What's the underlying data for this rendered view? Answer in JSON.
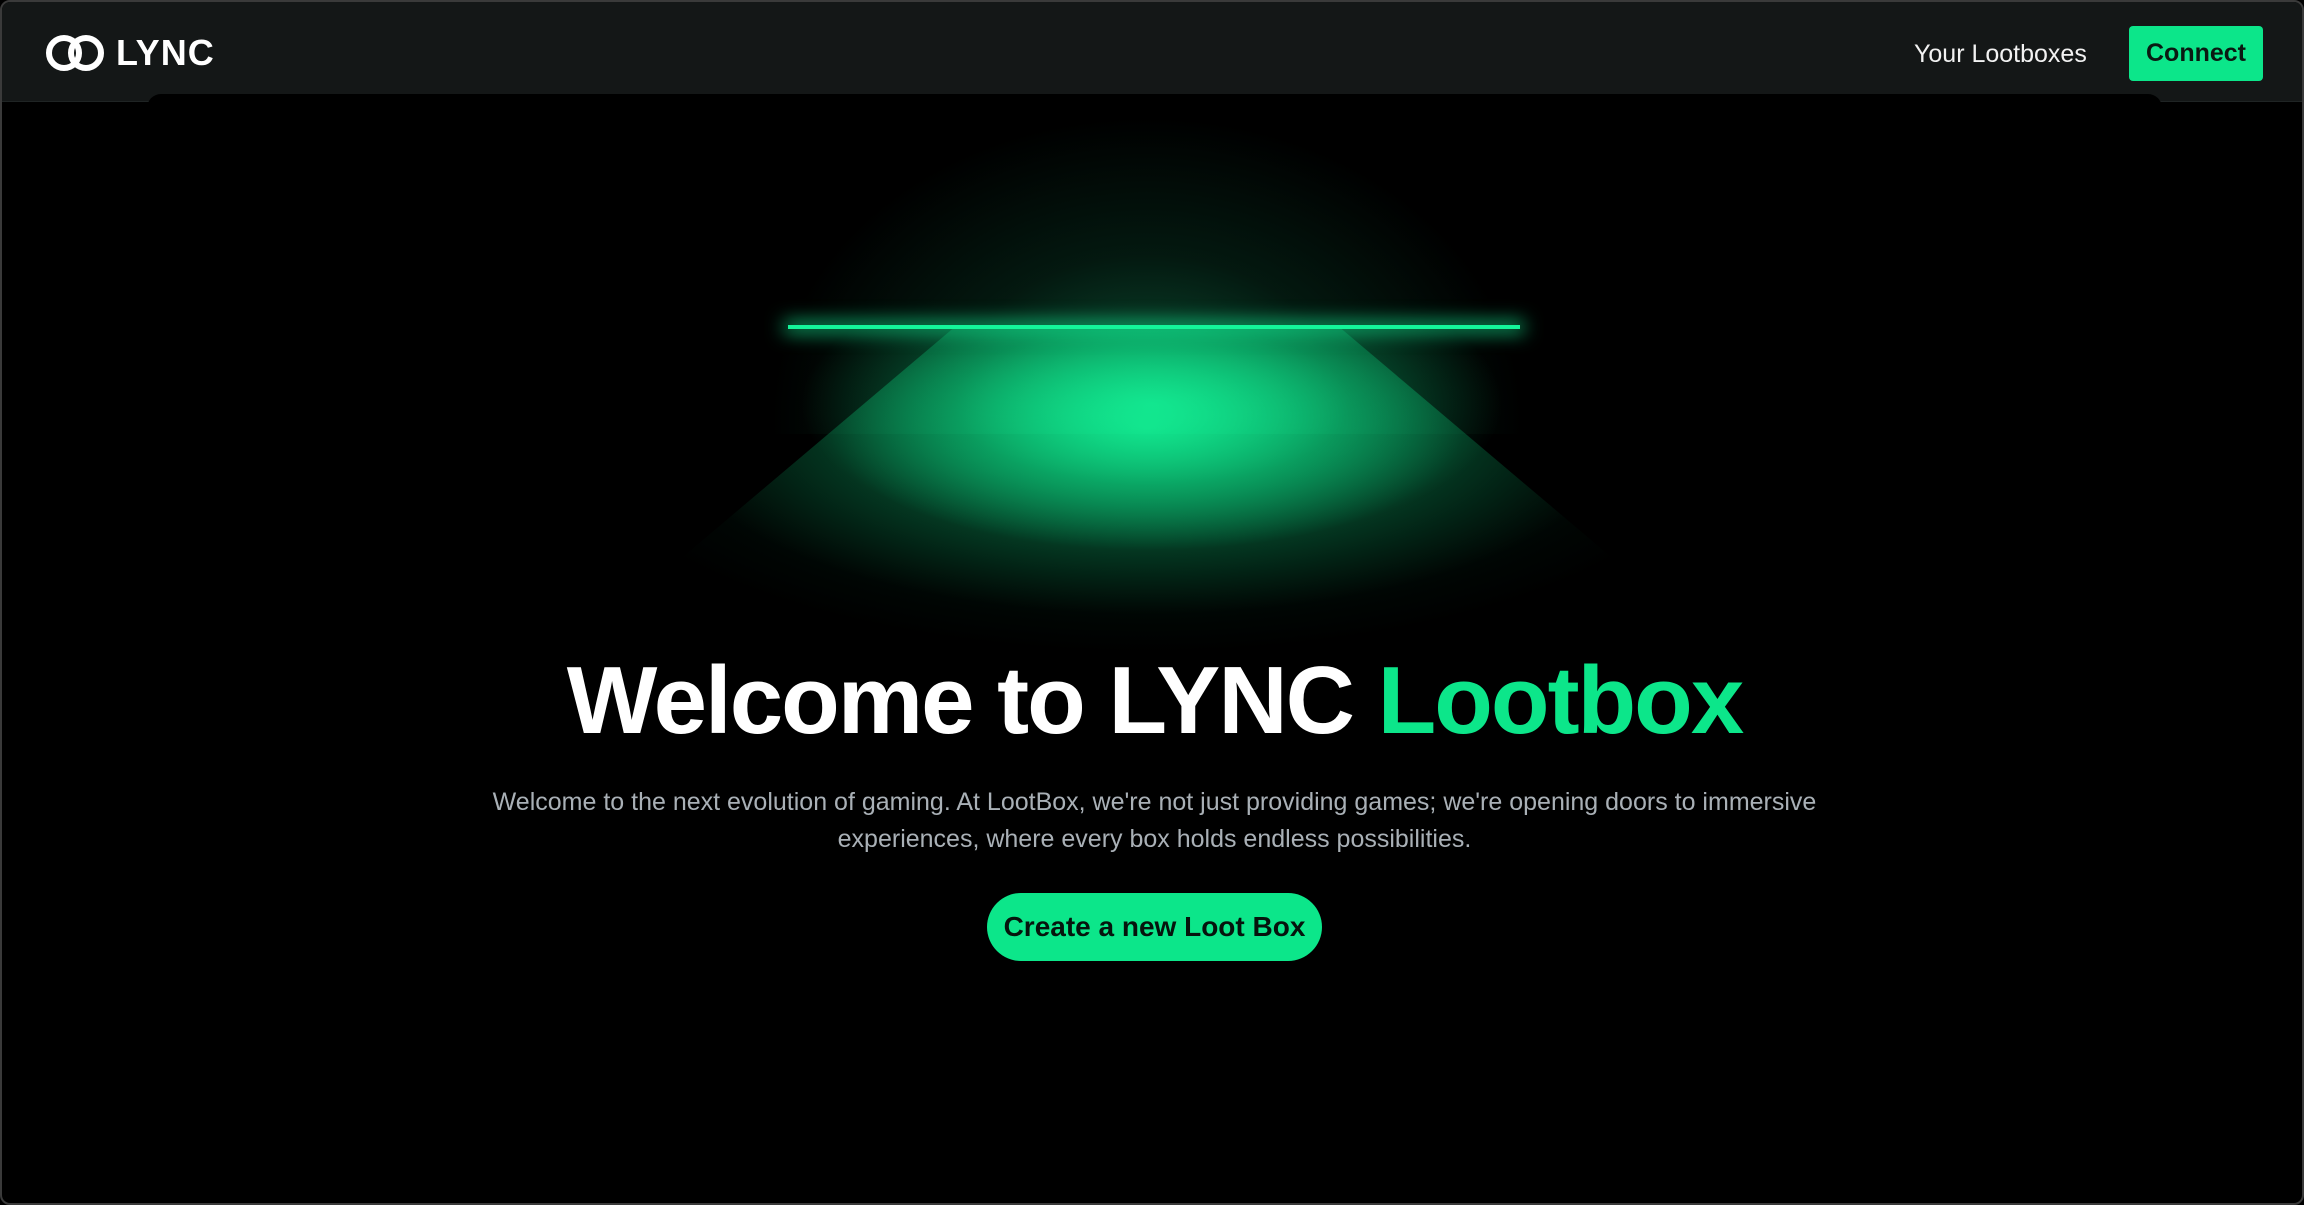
{
  "brand": {
    "name": "LYNC",
    "accent_color": "#0ce68a",
    "logo_icon": "linked-rings-icon"
  },
  "nav": {
    "links": [
      {
        "label": "Your Lootboxes"
      }
    ],
    "connect_label": "Connect"
  },
  "hero": {
    "title_main": "Welcome to LYNC ",
    "title_accent": "Lootbox",
    "description": "Welcome to the next evolution of gaming. At LootBox, we're not just providing games; we're opening doors to immersive experiences, where every box holds endless possibilities.",
    "cta_label": "Create a new Loot Box",
    "glow_color": "#14f59a"
  }
}
